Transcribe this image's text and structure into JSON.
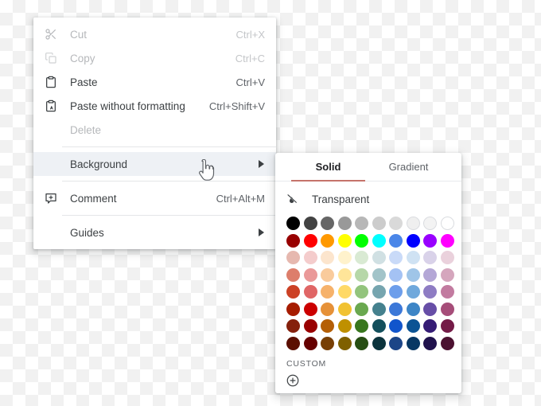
{
  "context_menu": {
    "items": [
      {
        "id": "cut",
        "label": "Cut",
        "accel": "Ctrl+X",
        "icon": "scissors-icon",
        "state": "disabled"
      },
      {
        "id": "copy",
        "label": "Copy",
        "accel": "Ctrl+C",
        "icon": "copy-icon",
        "state": "disabled"
      },
      {
        "id": "paste",
        "label": "Paste",
        "accel": "Ctrl+V",
        "icon": "clipboard-icon",
        "state": "enabled"
      },
      {
        "id": "paste-without-formatting",
        "label": "Paste without formatting",
        "accel": "Ctrl+Shift+V",
        "icon": "clipboard-text-icon",
        "state": "enabled"
      },
      {
        "id": "delete",
        "label": "Delete",
        "accel": "",
        "icon": "",
        "state": "disabled"
      },
      {
        "id": "background",
        "label": "Background",
        "accel": "",
        "icon": "",
        "state": "highlighted",
        "submenu": true
      },
      {
        "id": "comment",
        "label": "Comment",
        "accel": "Ctrl+Alt+M",
        "icon": "comment-plus-icon",
        "state": "enabled"
      },
      {
        "id": "guides",
        "label": "Guides",
        "accel": "",
        "icon": "",
        "state": "enabled",
        "submenu": true
      }
    ],
    "submenu_arrow": "▶"
  },
  "color_panel": {
    "tabs": [
      {
        "id": "solid",
        "label": "Solid",
        "active": true
      },
      {
        "id": "gradient",
        "label": "Gradient",
        "active": false
      }
    ],
    "active_tab_underline_color": "#c5736b",
    "transparent": {
      "label": "Transparent",
      "icon": "no-fill-icon"
    },
    "custom": {
      "label": "CUSTOM",
      "add_icon": "plus-circle-icon"
    },
    "grid": {
      "columns": 10,
      "rows": 8,
      "colors": [
        [
          "#000000",
          "#434343",
          "#666666",
          "#999999",
          "#b7b7b7",
          "#cccccc",
          "#d9d9d9",
          "#efefef",
          "#f3f3f3",
          "#ffffff"
        ],
        [
          "#980000",
          "#ff0000",
          "#ff9900",
          "#ffff00",
          "#00ff00",
          "#00ffff",
          "#4a86e8",
          "#0000ff",
          "#9900ff",
          "#ff00ff"
        ],
        [
          "#e6b8af",
          "#f4cccc",
          "#fce5cd",
          "#fff2cc",
          "#d9ead3",
          "#d0e0e3",
          "#c9daf8",
          "#cfe2f3",
          "#d9d2e9",
          "#ead1dc"
        ],
        [
          "#dd7e6b",
          "#ea9999",
          "#f9cb9c",
          "#ffe599",
          "#b6d7a8",
          "#a2c4c9",
          "#a4c2f4",
          "#9fc5e8",
          "#b4a7d6",
          "#d5a6bd"
        ],
        [
          "#cc4125",
          "#e06666",
          "#f6b26b",
          "#ffd966",
          "#93c47d",
          "#76a5af",
          "#6d9eeb",
          "#6fa8dc",
          "#8e7cc3",
          "#c27ba0"
        ],
        [
          "#a61c00",
          "#cc0000",
          "#e69138",
          "#f1c232",
          "#6aa84f",
          "#45818e",
          "#3c78d8",
          "#3d85c6",
          "#674ea7",
          "#a64d79"
        ],
        [
          "#85200c",
          "#990000",
          "#b45f06",
          "#bf9000",
          "#38761d",
          "#134f5c",
          "#1155cc",
          "#0b5394",
          "#351c75",
          "#741b47"
        ],
        [
          "#5b0f00",
          "#660000",
          "#783f04",
          "#7f6000",
          "#274e13",
          "#0c343d",
          "#1c4587",
          "#073763",
          "#20124d",
          "#4c1130"
        ]
      ]
    }
  }
}
